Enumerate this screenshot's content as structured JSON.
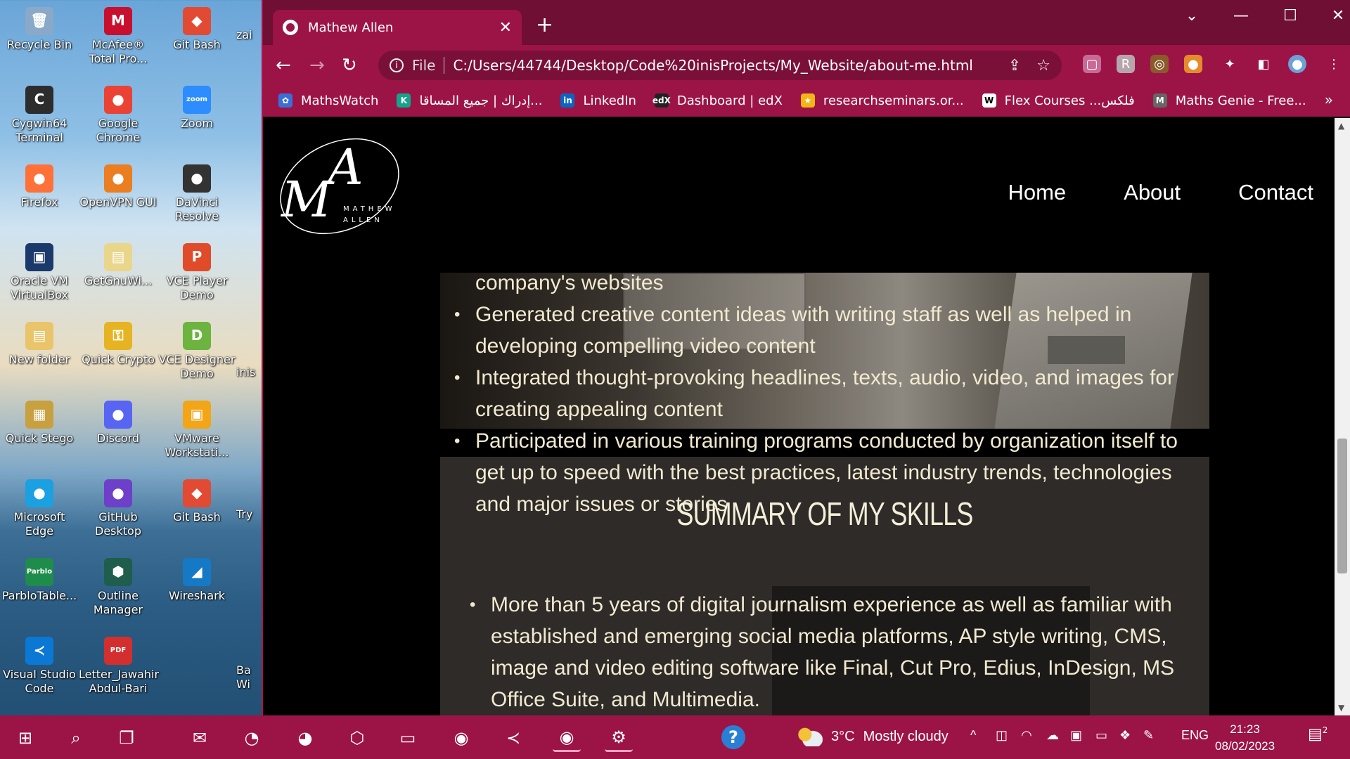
{
  "desktop": {
    "icons": [
      {
        "label": "Recycle Bin",
        "color": "#8aa9c8",
        "glyph": "🗑"
      },
      {
        "label": "McAfee® Total Pro...",
        "color": "#c8102e",
        "glyph": "M"
      },
      {
        "label": "Git Bash",
        "color": "#e24a34",
        "glyph": "◆"
      },
      {
        "label": "Cygwin64 Terminal",
        "color": "#2d2d2d",
        "glyph": "C"
      },
      {
        "label": "Google Chrome",
        "color": "#ea4335",
        "glyph": "●"
      },
      {
        "label": "Zoom",
        "color": "#2d8cff",
        "glyph": "zoom"
      },
      {
        "label": "Firefox",
        "color": "#ff7139",
        "glyph": "●"
      },
      {
        "label": "OpenVPN GUI",
        "color": "#ea7e20",
        "glyph": "●"
      },
      {
        "label": "DaVinci Resolve",
        "color": "#333",
        "glyph": "●"
      },
      {
        "label": "Oracle VM VirtualBox",
        "color": "#1b3a6b",
        "glyph": "▣"
      },
      {
        "label": "GetGnuWi...",
        "color": "#e9d68a",
        "glyph": "▤"
      },
      {
        "label": "VCE Player Demo",
        "color": "#e04b2a",
        "glyph": "P"
      },
      {
        "label": "New folder",
        "color": "#e9c46a",
        "glyph": "▤"
      },
      {
        "label": "Quick Crypto",
        "color": "#e6b422",
        "glyph": "⚿"
      },
      {
        "label": "VCE Designer Demo",
        "color": "#6cb33f",
        "glyph": "D"
      },
      {
        "label": "Quick Stego",
        "color": "#c8a040",
        "glyph": "▦"
      },
      {
        "label": "Discord",
        "color": "#5865f2",
        "glyph": "●"
      },
      {
        "label": "VMware Workstati...",
        "color": "#f2a516",
        "glyph": "▣"
      },
      {
        "label": "Microsoft Edge",
        "color": "#1ba0e2",
        "glyph": "●"
      },
      {
        "label": "GitHub Desktop",
        "color": "#6e40c9",
        "glyph": "●"
      },
      {
        "label": "Git Bash",
        "color": "#e24a34",
        "glyph": "◆"
      },
      {
        "label": "ParbloTable...",
        "color": "#1e8c4a",
        "glyph": "Parblo"
      },
      {
        "label": "Outline Manager",
        "color": "#1f5d4c",
        "glyph": "⬢"
      },
      {
        "label": "Wireshark",
        "color": "#1679c5",
        "glyph": "◢"
      },
      {
        "label": "Visual Studio Code",
        "color": "#0a78d4",
        "glyph": "≺"
      },
      {
        "label": "Letter_Jawahir Abdul-Bari",
        "color": "#d32f2f",
        "glyph": "PDF"
      }
    ],
    "clipped_labels": [
      "zai",
      "inis",
      "Try",
      "Ba Wi"
    ]
  },
  "browser": {
    "tab_title": "Mathew Allen",
    "tab_close": "✕",
    "new_tab": "+",
    "window_controls": [
      "⌄",
      "—",
      "☐",
      "✕"
    ],
    "nav": {
      "back": "←",
      "forward": "→",
      "reload": "↻"
    },
    "omnibox": {
      "info": "i",
      "scheme_label": "File",
      "url": "C:/Users/44744/Desktop/Code%20inisProjects/My_Website/about-me.html",
      "share_icon": "⇪",
      "star_icon": "☆"
    },
    "extensions": [
      {
        "name": "extension-pink-icon",
        "color": "#c86a94",
        "glyph": "▢"
      },
      {
        "name": "extension-grey-icon",
        "color": "#b7a5ad",
        "glyph": "R"
      },
      {
        "name": "cookie-icon",
        "color": "#8a5a2b",
        "glyph": "◎"
      },
      {
        "name": "extension-orange-icon",
        "color": "#e58b2b",
        "glyph": "●"
      },
      {
        "name": "puzzle-icon",
        "color": "transparent",
        "glyph": "✦"
      },
      {
        "name": "sidepanel-icon",
        "color": "transparent",
        "glyph": "◧"
      },
      {
        "name": "profile-avatar-icon",
        "color": "#6ea0d8",
        "glyph": "●"
      },
      {
        "name": "menu-kebab-icon",
        "color": "transparent",
        "glyph": "⋮"
      }
    ],
    "bookmarks": [
      {
        "label": "MathsWatch",
        "color": "#3b6fd8",
        "glyph": "✿"
      },
      {
        "label": "إدراك | جميع المساقا...",
        "color": "#14a38b",
        "glyph": "K"
      },
      {
        "label": "LinkedIn",
        "color": "#0a66c2",
        "glyph": "in"
      },
      {
        "label": "Dashboard | edX",
        "color": "#222",
        "glyph": "edX"
      },
      {
        "label": "researchseminars.or...",
        "color": "#f3b515",
        "glyph": "★"
      },
      {
        "label": "Flex Courses ...فلكس",
        "color": "#fff",
        "glyph": "W"
      },
      {
        "label": "Maths Genie - Free...",
        "color": "#666",
        "glyph": "M"
      }
    ],
    "bookmarks_more": "»"
  },
  "site": {
    "logo": {
      "big": "MA",
      "small_top": "MATHEW",
      "small_bottom": "ALLEN"
    },
    "nav": [
      "Home",
      "About",
      "Contact"
    ],
    "experience_lines": [
      {
        "text": "company's websites",
        "bullet": false
      },
      {
        "text": "Generated creative content ideas with writing staff as well as helped in developing compelling video content",
        "bullet": true
      },
      {
        "text": "Integrated thought-provoking headlines, texts, audio, video, and images for creating appealing content",
        "bullet": true
      },
      {
        "text": "Participated in various training programs conducted by organization itself to get up to speed with the best practices, latest industry trends, technologies and major issues or stories",
        "bullet": true
      }
    ],
    "skills_title": "SUMMARY OF MY SKILLS",
    "skills": [
      "More than 5 years of digital journalism experience as well as familiar with established and emerging social media platforms, AP style writing, CMS, image and video editing software like Final, Cut Pro, Edius, InDesign, MS Office Suite, and Multimedia."
    ]
  },
  "taskbar": {
    "apps": [
      {
        "name": "start-button",
        "glyph": "⊞"
      },
      {
        "name": "search-icon",
        "glyph": "⌕"
      },
      {
        "name": "task-view-icon",
        "glyph": "❐"
      },
      {
        "name": "mail-icon",
        "glyph": "✉"
      },
      {
        "name": "edge-icon",
        "glyph": "◔"
      },
      {
        "name": "firefox-icon",
        "glyph": "◕"
      },
      {
        "name": "app-blue-icon",
        "glyph": "⬡"
      },
      {
        "name": "file-explorer-icon",
        "glyph": "▭"
      },
      {
        "name": "chrome-profile-icon",
        "glyph": "◉"
      },
      {
        "name": "vscode-icon",
        "glyph": "≺"
      },
      {
        "name": "chrome-active-icon",
        "glyph": "◉"
      },
      {
        "name": "settings-gear-icon",
        "glyph": "⚙"
      }
    ],
    "help_icon": "?",
    "weather": {
      "temp": "3°C",
      "condition": "Mostly cloudy"
    },
    "tray": {
      "chevron": "^",
      "lang": "ENG"
    },
    "clock": {
      "time": "21:23",
      "date": "08/02/2023"
    },
    "notifications": "2"
  }
}
